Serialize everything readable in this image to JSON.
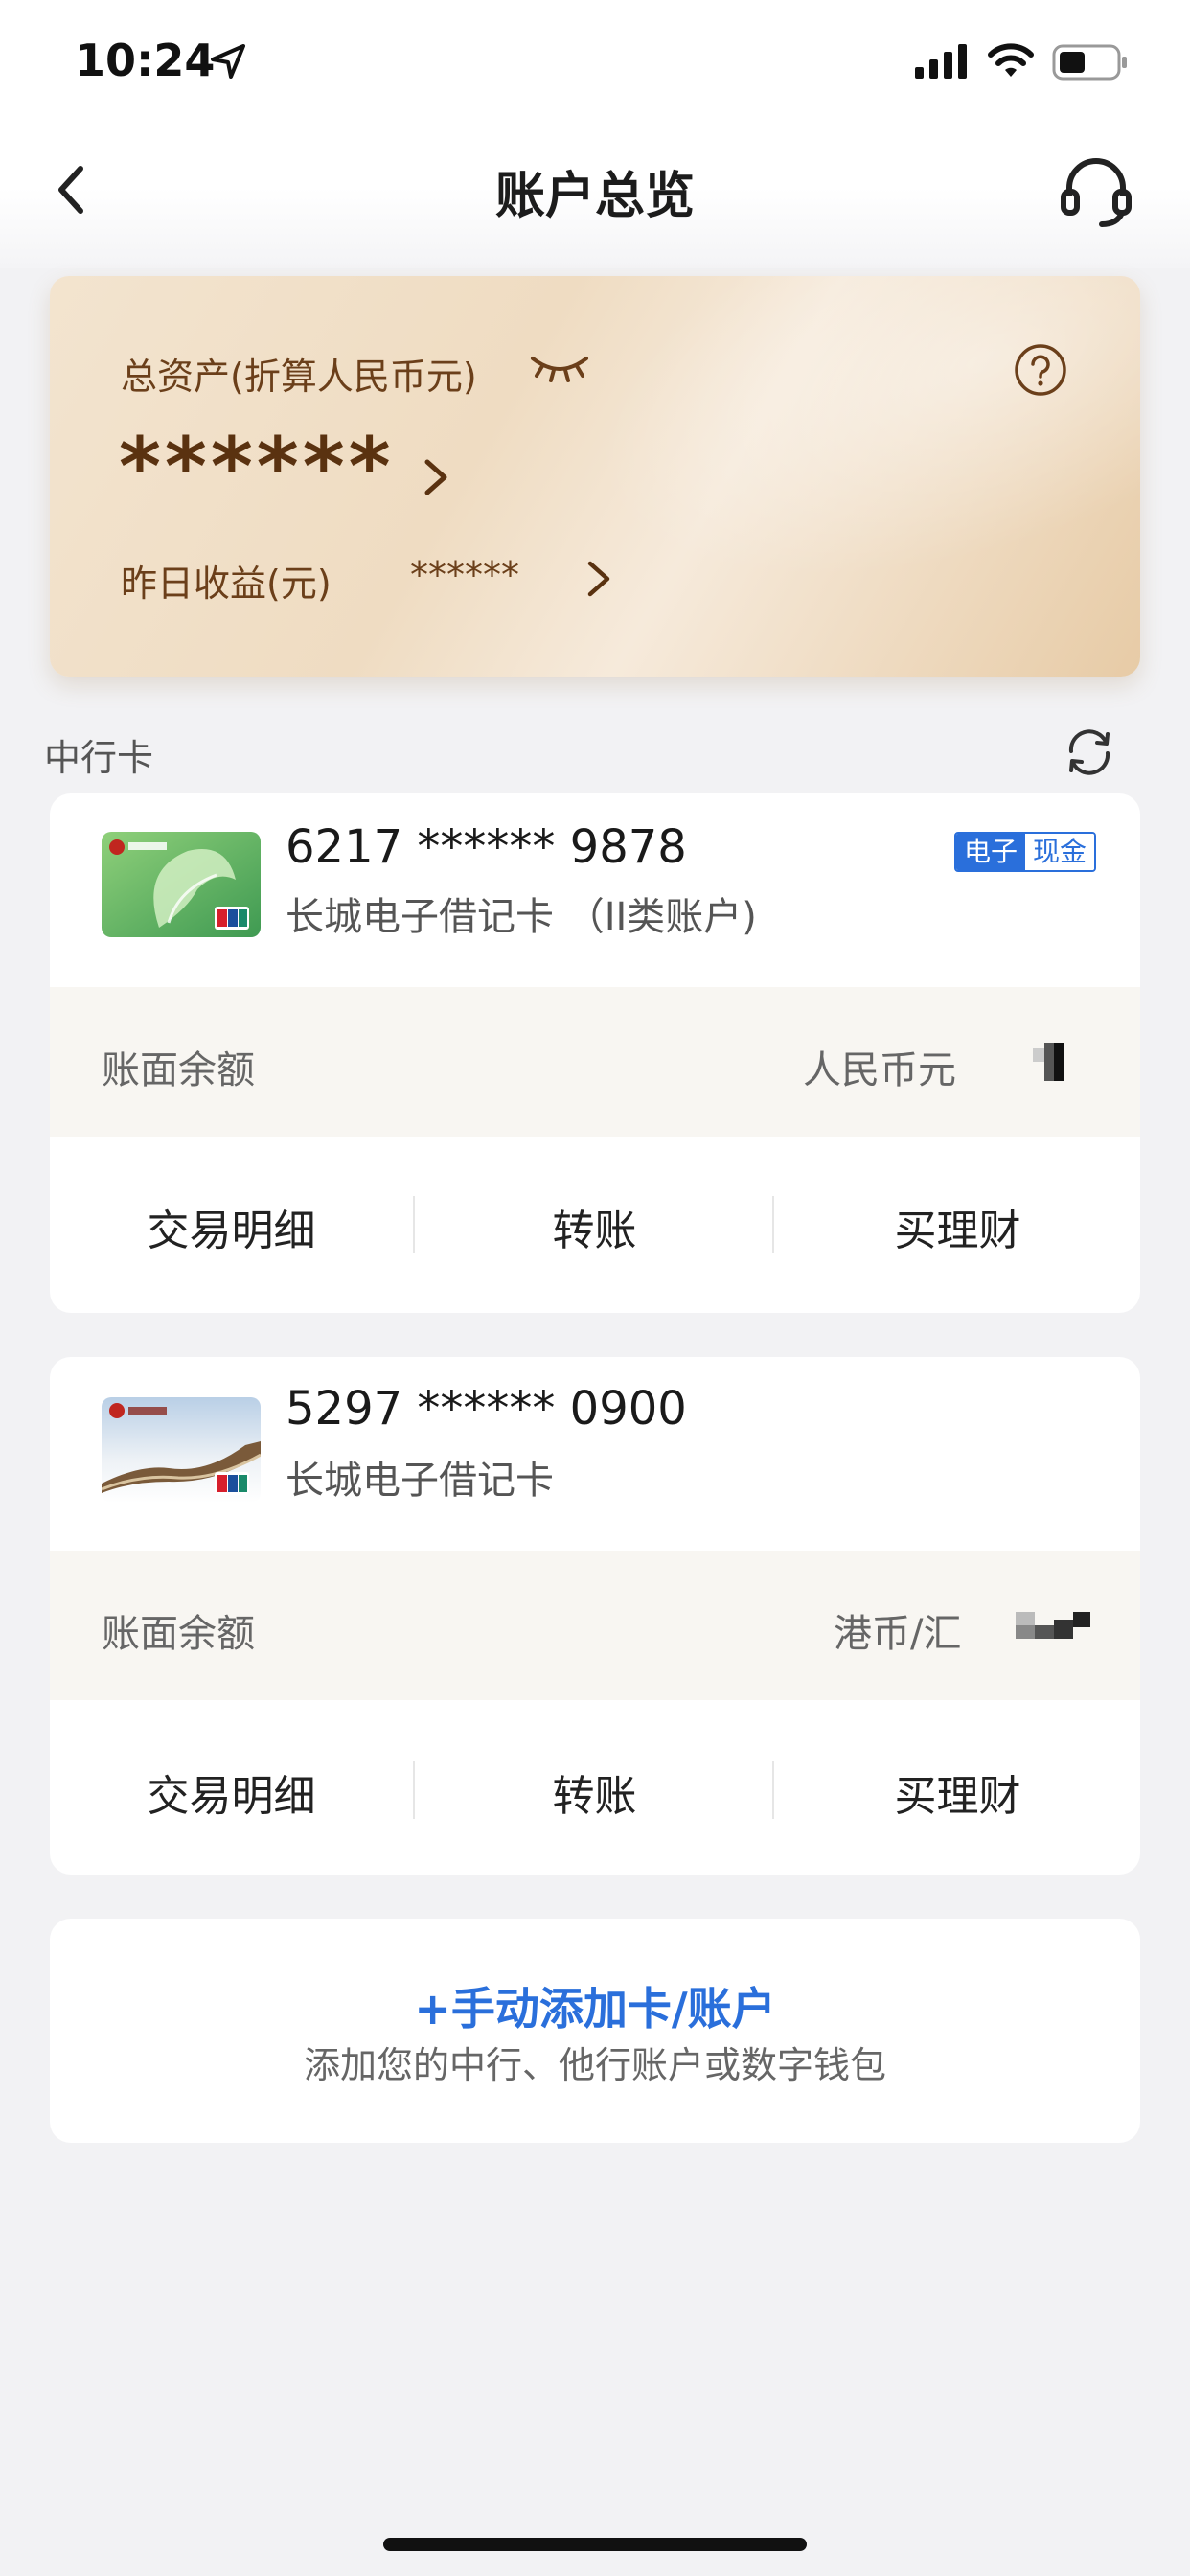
{
  "status_bar": {
    "time": "10:24"
  },
  "nav": {
    "title": "账户总览"
  },
  "assets": {
    "label": "总资产(折算人民币元)",
    "value": "******",
    "yesterday_label": "昨日收益(元)",
    "yesterday_value": "******"
  },
  "section": {
    "title": "中行卡"
  },
  "accounts": [
    {
      "number": "6217 ****** 9878",
      "type": "长城电子借记卡 （II类账户)",
      "badge_left": "电子",
      "badge_right": "现金",
      "balance_label": "账面余额",
      "currency": "人民币元",
      "actions": [
        "交易明细",
        "转账",
        "买理财"
      ]
    },
    {
      "number": "5297 ****** 0900",
      "type": "长城电子借记卡",
      "balance_label": "账面余额",
      "currency": "港币/汇",
      "actions": [
        "交易明细",
        "转账",
        "买理财"
      ]
    }
  ],
  "add_account": {
    "title": "+手动添加卡/账户",
    "subtitle": "添加您的中行、他行账户或数字钱包"
  },
  "colors": {
    "accent": "#2a6fdb",
    "asset_text": "#6b3f1a",
    "page_bg": "#f2f2f4"
  }
}
